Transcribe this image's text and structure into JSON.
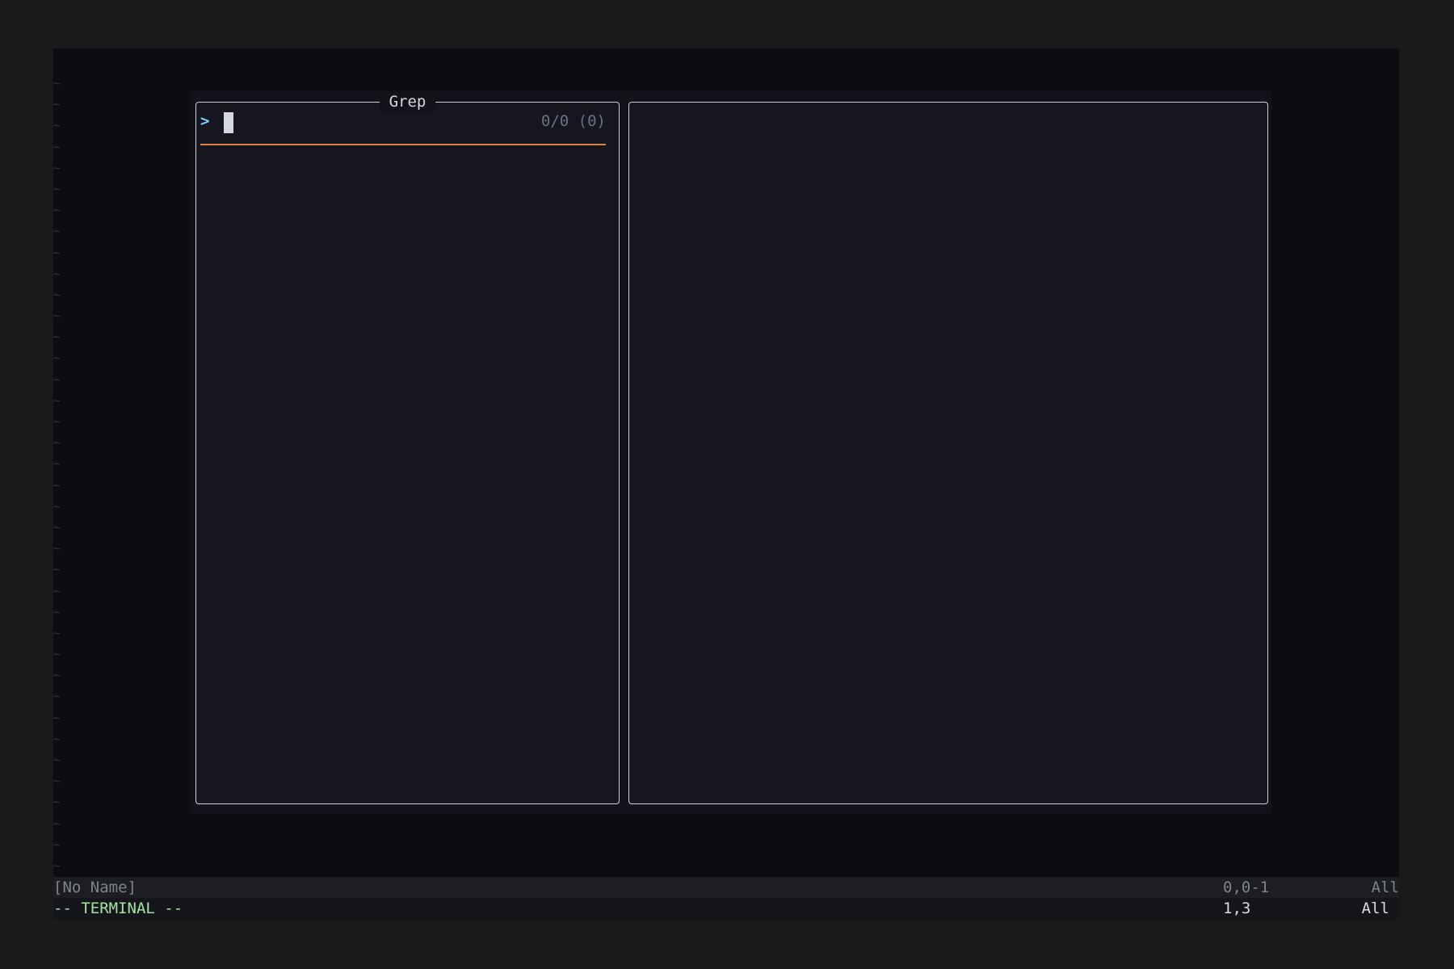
{
  "colors": {
    "background": "#1a1a1a",
    "editor_bg": "#0b0d11",
    "float_bg": "#121318",
    "pane_bg": "#15161e",
    "border": "#cdd0d6",
    "prompt_accent": "#7dcfff",
    "divider_accent": "#d9824b",
    "terminal_mode": "#a6e3a1"
  },
  "editor": {
    "empty_line_marker": "~"
  },
  "picker": {
    "title": "Grep",
    "prompt_symbol": ">",
    "input_value": "",
    "count": "0/0 (0)"
  },
  "statusline": {
    "filename": "[No Name]",
    "position": "0,0-1",
    "scroll": "All"
  },
  "cmdline": {
    "mode": "-- TERMINAL --",
    "position": "1,3",
    "scroll": "All"
  }
}
